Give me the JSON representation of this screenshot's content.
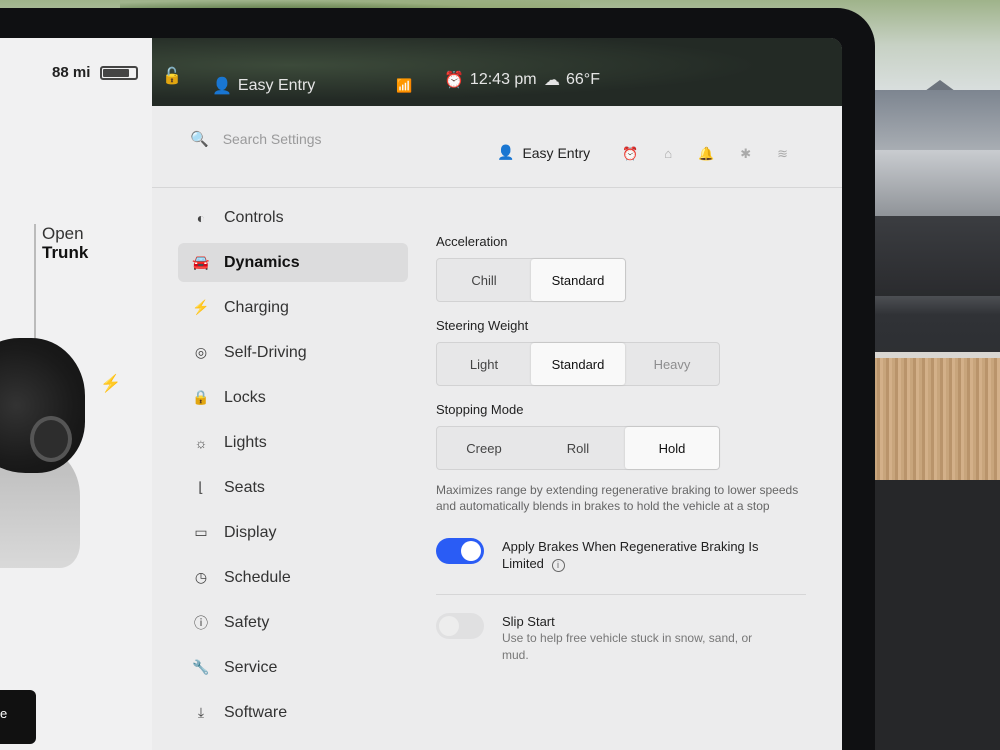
{
  "vehicle": {
    "range": "88 mi",
    "battery_level": 0.75,
    "trunk_label_1": "Open",
    "trunk_label_2": "Trunk",
    "bottom_button": "e"
  },
  "statusbar": {
    "profile": "Easy Entry",
    "time": "12:43 pm",
    "temperature": "66°F"
  },
  "header": {
    "search_placeholder": "Search Settings",
    "profile": "Easy Entry"
  },
  "nav": {
    "items": [
      {
        "label": "Controls",
        "icon": "toggle-icon"
      },
      {
        "label": "Dynamics",
        "icon": "car-icon"
      },
      {
        "label": "Charging",
        "icon": "bolt-icon"
      },
      {
        "label": "Self-Driving",
        "icon": "steering-wheel-icon"
      },
      {
        "label": "Locks",
        "icon": "lock-icon"
      },
      {
        "label": "Lights",
        "icon": "sun-icon"
      },
      {
        "label": "Seats",
        "icon": "seat-icon"
      },
      {
        "label": "Display",
        "icon": "display-icon"
      },
      {
        "label": "Schedule",
        "icon": "clock-icon"
      },
      {
        "label": "Safety",
        "icon": "alert-icon"
      },
      {
        "label": "Service",
        "icon": "wrench-icon"
      },
      {
        "label": "Software",
        "icon": "download-icon"
      }
    ],
    "active": "Dynamics"
  },
  "dynamics": {
    "acceleration": {
      "label": "Acceleration",
      "options": [
        "Chill",
        "Standard"
      ],
      "selected": "Standard"
    },
    "steering": {
      "label": "Steering Weight",
      "options": [
        "Light",
        "Standard",
        "Heavy"
      ],
      "selected": "Standard"
    },
    "stopping": {
      "label": "Stopping Mode",
      "options": [
        "Creep",
        "Roll",
        "Hold"
      ],
      "selected": "Hold"
    },
    "stopping_desc": "Maximizes range by extending regenerative braking to lower speeds and automatically blends in brakes to hold the vehicle at a stop",
    "apply_brakes": {
      "label": "Apply Brakes When Regenerative Braking Is Limited",
      "enabled": true
    },
    "slip_start": {
      "label": "Slip Start",
      "desc": "Use to help free vehicle stuck in snow, sand, or mud.",
      "enabled": false
    }
  },
  "colors": {
    "accent": "#2a5cf5",
    "panel": "#ececed",
    "active_nav": "#dcdcdd"
  }
}
